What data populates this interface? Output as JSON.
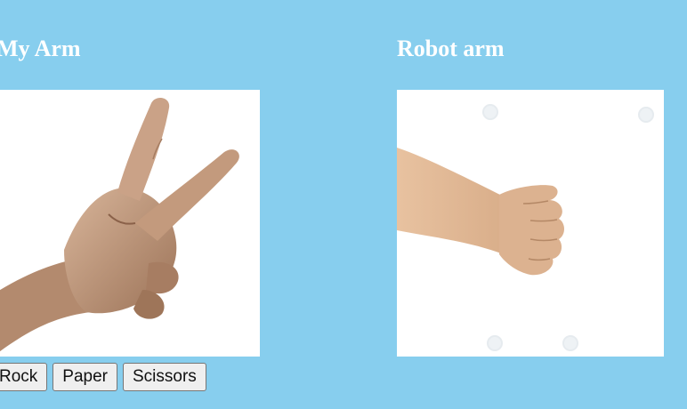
{
  "background_color": "#87ceee",
  "my_arm": {
    "title": "My Arm",
    "image": {
      "icon": "scissors-hand-icon"
    },
    "buttons": [
      {
        "label": "Rock"
      },
      {
        "label": "Paper"
      },
      {
        "label": "Scissors"
      }
    ]
  },
  "robot_arm": {
    "title": "Robot arm",
    "image": {
      "icon": "rock-fist-icon"
    }
  }
}
